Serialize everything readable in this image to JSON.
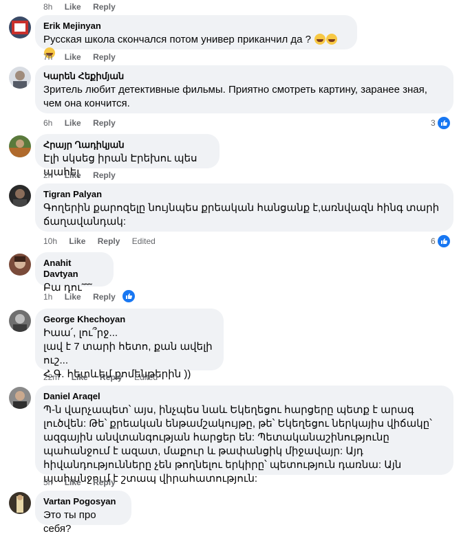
{
  "top": {
    "time": "8h",
    "like": "Like",
    "reply": "Reply"
  },
  "comments": [
    {
      "author": "Erik Mejinyan",
      "text": "Русская школа скончался потом универ приканчил да ?",
      "time": "7h",
      "like": "Like",
      "reply": "Reply"
    },
    {
      "author": "Կարեն Հեքիմյան",
      "text": "Зритель любит детективные фильмы. Приятно смотреть картину, заранее зная, чем она кончится.",
      "time": "6h",
      "like": "Like",
      "reply": "Reply",
      "reactions": "3"
    },
    {
      "author": "Հրայր Ղադիկյան",
      "text": "Էլի սկսեց իրան Էրեխու պես պահել",
      "time": "2h",
      "like": "Like",
      "reply": "Reply"
    },
    {
      "author": "Tigran Palyan",
      "text": "Գողերին քարոզելը նույնպես քրեական հանցանք է,առնվազն հինգ տարի ճաղավանդակ:",
      "time": "10h",
      "like": "Like",
      "reply": "Reply",
      "edited": "Edited",
      "reactions": "6"
    },
    {
      "author": "Anahit Davtyan",
      "text": "Բա դու˜˜˜",
      "time": "1h",
      "like": "Like",
      "reply": "Reply"
    },
    {
      "author": "George Khechoyan",
      "text": "Իաա՛, լու՞րջ...\nլավ է 7 տարի հետո, քան ավելի ուշ...\nՀ.Գ. հետևեմ քոմենթերին ))",
      "time": "22m",
      "like": "Like",
      "reply": "Reply",
      "edited": "Edited"
    },
    {
      "author": "Daniel Araqel",
      "text": "Պ-ն վարչապետ՝ այս, ինչպես նաև Եկեղեցու հարցերը պետք է արագ լուծվեն: Թե՝ քրեական ենթամշակույթը, թե՝ Եկեղեցու ներկայիս վիճակը՝ ազգային անվտանգության հարցեր են: Պետականաշինությունը պահանջում է ազատ, մաքուր և թափանցիկ միջավայր: Այդ հիվանդությունները չեն թողնելու երկիրը՝ պետություն դառնա: Այն պահանջում է շտապ վիրահատություն:",
      "time": "5h",
      "like": "Like",
      "reply": "Reply"
    },
    {
      "author": "Vartan Pogosyan",
      "text": "Это ты про себя?"
    }
  ],
  "colors": {
    "bubble": "#f0f2f5",
    "meta": "#65676b",
    "like_blue": "#1877f2"
  }
}
